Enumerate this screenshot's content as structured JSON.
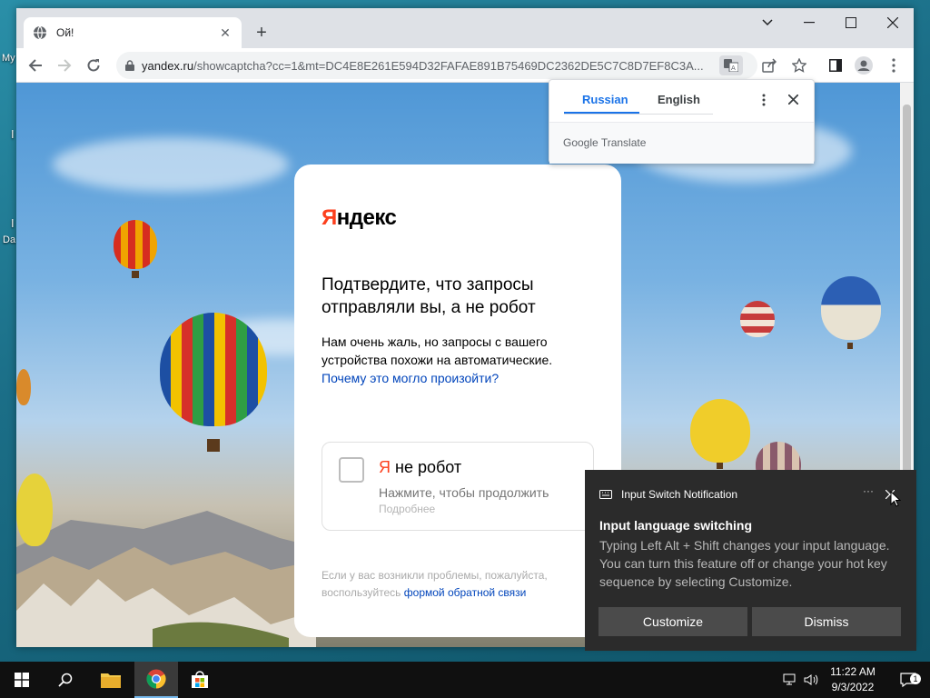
{
  "desktop": {
    "labels": [
      "My",
      "I",
      "I",
      "Da"
    ]
  },
  "browser": {
    "tab_title": "Ой!",
    "url_host": "yandex.ru",
    "url_path": "/showcaptcha?cc=1&mt=DC4E8E261E594D32FAFAE891B75469DC2362DE5C7C8D7EF8C3A..."
  },
  "translate": {
    "tab_active": "Russian",
    "tab_other": "English",
    "brand": "Google Translate"
  },
  "captcha": {
    "logo_first": "Я",
    "logo_rest": "ндекс",
    "title": "Подтвердите, что запросы отправляли вы, а не робот",
    "text": "Нам очень жаль, но запросы с вашего устройства похожи на автоматические.",
    "text_link": "Почему это могло произойти?",
    "robot_ya": "Я",
    "robot_label": " не робот",
    "robot_hint": "Нажмите, чтобы продолжить",
    "robot_more": "Подробнее",
    "foot_text": "Если у вас возникли проблемы, пожалуйста, воспользуйтесь",
    "foot_link": "формой обратной связи"
  },
  "notification": {
    "app": "Input Switch Notification",
    "more": "···",
    "title": "Input language switching",
    "body": "Typing Left Alt + Shift changes your input language. You can turn this feature off or change your hot key sequence by selecting Customize.",
    "customize": "Customize",
    "dismiss": "Dismiss"
  },
  "taskbar": {
    "time": "11:22 AM",
    "date": "9/3/2022",
    "notif_count": "1"
  },
  "colors": {
    "yandex_red": "#fc3f1d",
    "link_blue": "#0044bb",
    "google_blue": "#1a73e8"
  }
}
